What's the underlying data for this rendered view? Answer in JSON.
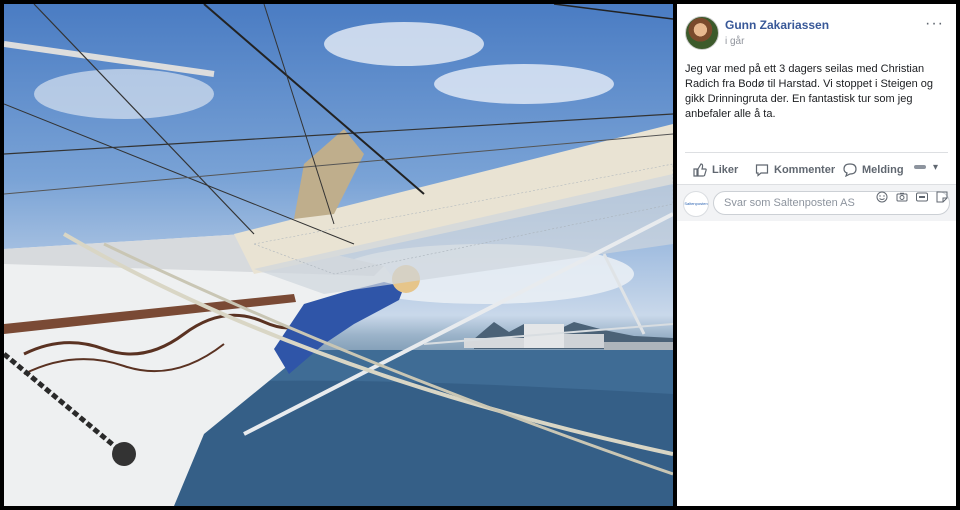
{
  "post": {
    "author": "Gunn Zakariassen",
    "time": "i går",
    "more_icon": "···",
    "text": "Jeg var med på ett 3 dagers seilas med Christian Radich fra Bodø til Harstad. Vi stoppet i Steigen og gikk Drinningruta der. En fantastisk tur som jeg anbefaler alle å ta."
  },
  "actions": {
    "like_label": "Liker",
    "comment_label": "Kommenter",
    "message_label": "Melding"
  },
  "comment": {
    "avatar_text": "Saltenposten",
    "placeholder": "Svar som Saltenposten AS",
    "icons": [
      "emoji-icon",
      "camera-icon",
      "gif-icon",
      "sticker-icon"
    ]
  },
  "colors": {
    "author": "#385898",
    "text": "#1c1e21",
    "muted": "#606770"
  }
}
